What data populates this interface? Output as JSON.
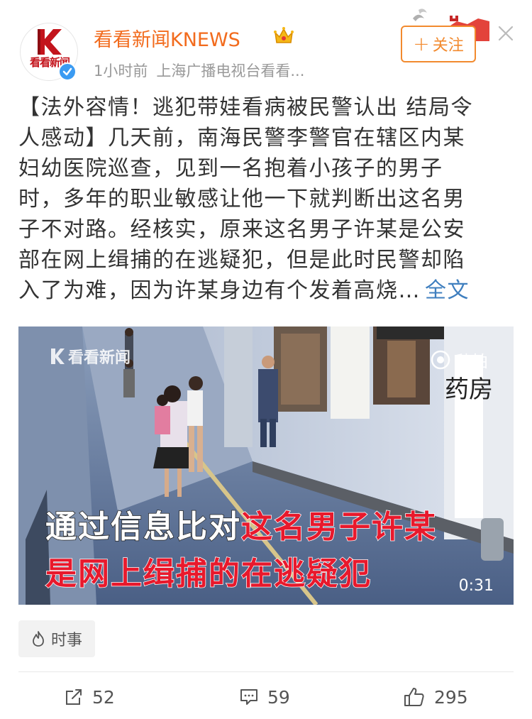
{
  "account": {
    "name": "看看新闻KNEWS",
    "avatar_text": "看看新闻",
    "time": "1小时前",
    "source": "上海广播电视台看看...",
    "verified_icon": "verified-badge-icon",
    "member_icon": "crown-icon"
  },
  "header": {
    "follow_label": "关注",
    "close_icon": "close-icon"
  },
  "post": {
    "lines": [
      "【法外容情！逃犯带娃看病被民警认出 结局令",
      "人感动】几天前，南海民警李警官在辖区内某",
      "妇幼医院巡查，见到一名抱着小孩子的男子",
      "时，多年的职业敏感让他一下就判断出这名男",
      "子不对路。经核实，原来这名男子许某是公安",
      "部在网上缉捕的在逃疑犯，但是此时民警却陷",
      "入了为难，因为许某身边有个发着高烧…"
    ],
    "more_label": "全文"
  },
  "video": {
    "watermark": "看看新闻",
    "miaopai": "秒拍",
    "pharmacy_sign": "药房",
    "caption_line1_white": "通过信息比对",
    "caption_line1_red": "这名男子许某",
    "caption_line2_red": "是网上缉捕的在逃疑犯",
    "duration": "0:31"
  },
  "tag": {
    "label": "时事",
    "icon": "flame-icon"
  },
  "actions": {
    "repost_count": "52",
    "comment_count": "59",
    "like_count": "295"
  },
  "colors": {
    "name": "#f26b1d",
    "follow": "#f28a2e",
    "link": "#3f7fbf",
    "caption_red": "#e8192c",
    "verified": "#3b9bf2"
  }
}
